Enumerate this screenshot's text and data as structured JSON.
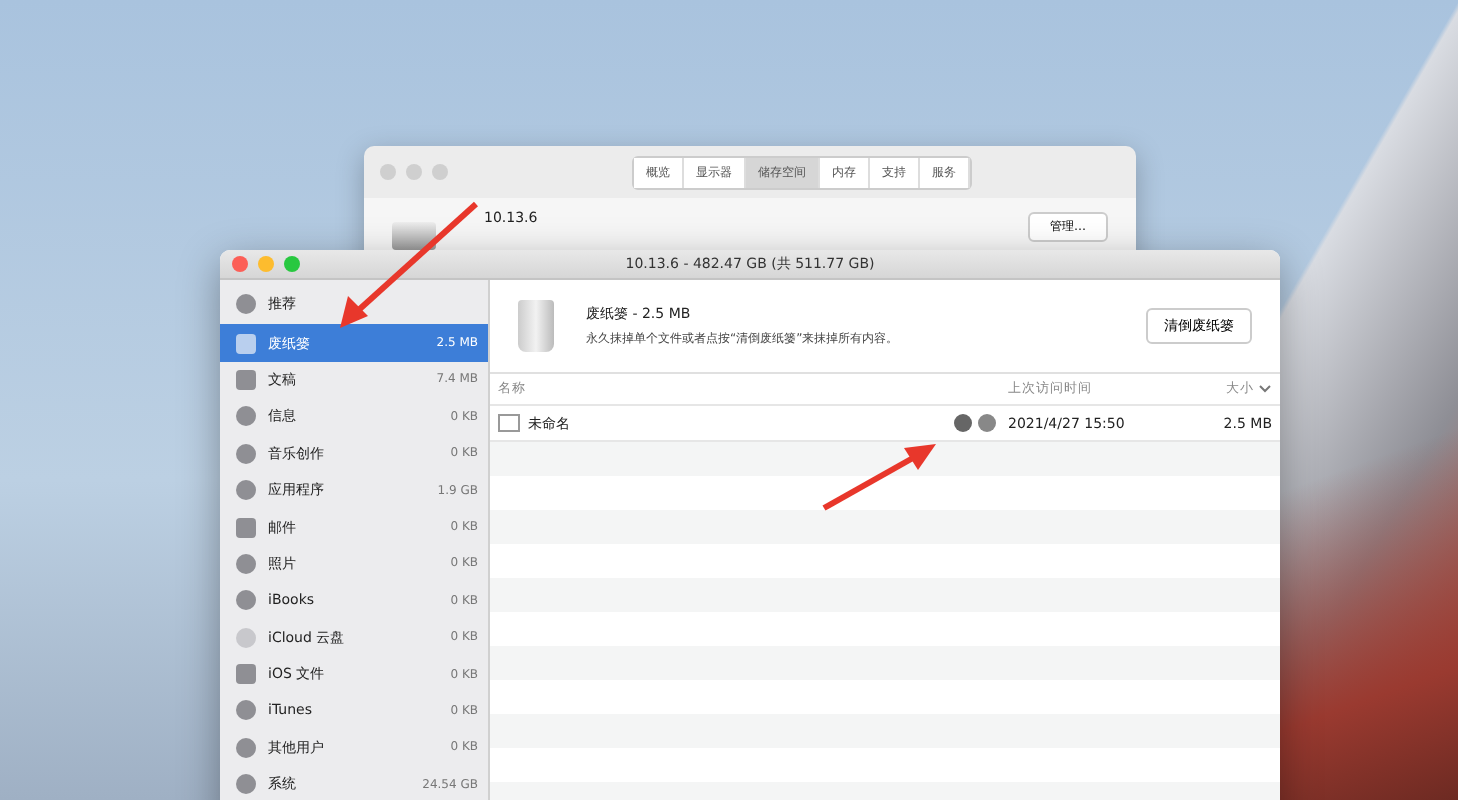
{
  "back_window": {
    "tabs": [
      {
        "label": "概览",
        "selected": false
      },
      {
        "label": "显示器",
        "selected": false
      },
      {
        "label": "储存空间",
        "selected": true
      },
      {
        "label": "内存",
        "selected": false
      },
      {
        "label": "支持",
        "selected": false
      },
      {
        "label": "服务",
        "selected": false
      }
    ],
    "disk_name": "10.13.6",
    "manage_button": "管理…"
  },
  "window": {
    "title": "10.13.6 - 482.47 GB (共 511.77 GB)"
  },
  "sidebar": {
    "items": [
      {
        "label": "推荐",
        "selected": false,
        "kind": "top"
      },
      {
        "label": "废纸篓",
        "size": "2.5 MB",
        "selected": true,
        "kind": "trash"
      },
      {
        "label": "文稿",
        "size": "7.4 MB",
        "selected": false,
        "kind": "doc"
      },
      {
        "label": "信息",
        "size": "0 KB",
        "selected": false,
        "kind": "chat"
      },
      {
        "label": "音乐创作",
        "size": "0 KB",
        "selected": false,
        "kind": "music"
      },
      {
        "label": "应用程序",
        "size": "1.9 GB",
        "selected": false,
        "kind": "app"
      },
      {
        "label": "邮件",
        "size": "0 KB",
        "selected": false,
        "kind": "mail"
      },
      {
        "label": "照片",
        "size": "0 KB",
        "selected": false,
        "kind": "photo"
      },
      {
        "label": "iBooks",
        "size": "0 KB",
        "selected": false,
        "kind": "book"
      },
      {
        "label": "iCloud 云盘",
        "size": "0 KB",
        "selected": false,
        "kind": "cloud"
      },
      {
        "label": "iOS 文件",
        "size": "0 KB",
        "selected": false,
        "kind": "phone"
      },
      {
        "label": "iTunes",
        "size": "0 KB",
        "selected": false,
        "kind": "note"
      },
      {
        "label": "其他用户",
        "size": "0 KB",
        "selected": false,
        "kind": "users"
      },
      {
        "label": "系统",
        "size": "24.54 GB",
        "selected": false,
        "kind": "system"
      }
    ]
  },
  "detail": {
    "title": "废纸篓 - 2.5 MB",
    "description": "永久抹掉单个文件或者点按“清倒废纸篓”来抹掉所有内容。",
    "empty_button": "清倒废纸篓"
  },
  "table": {
    "columns": [
      "名称",
      "上次访问时间",
      "大小"
    ],
    "rows": [
      {
        "name": "未命名",
        "date": "2021/4/27 15:50",
        "size": "2.5 MB"
      }
    ]
  }
}
